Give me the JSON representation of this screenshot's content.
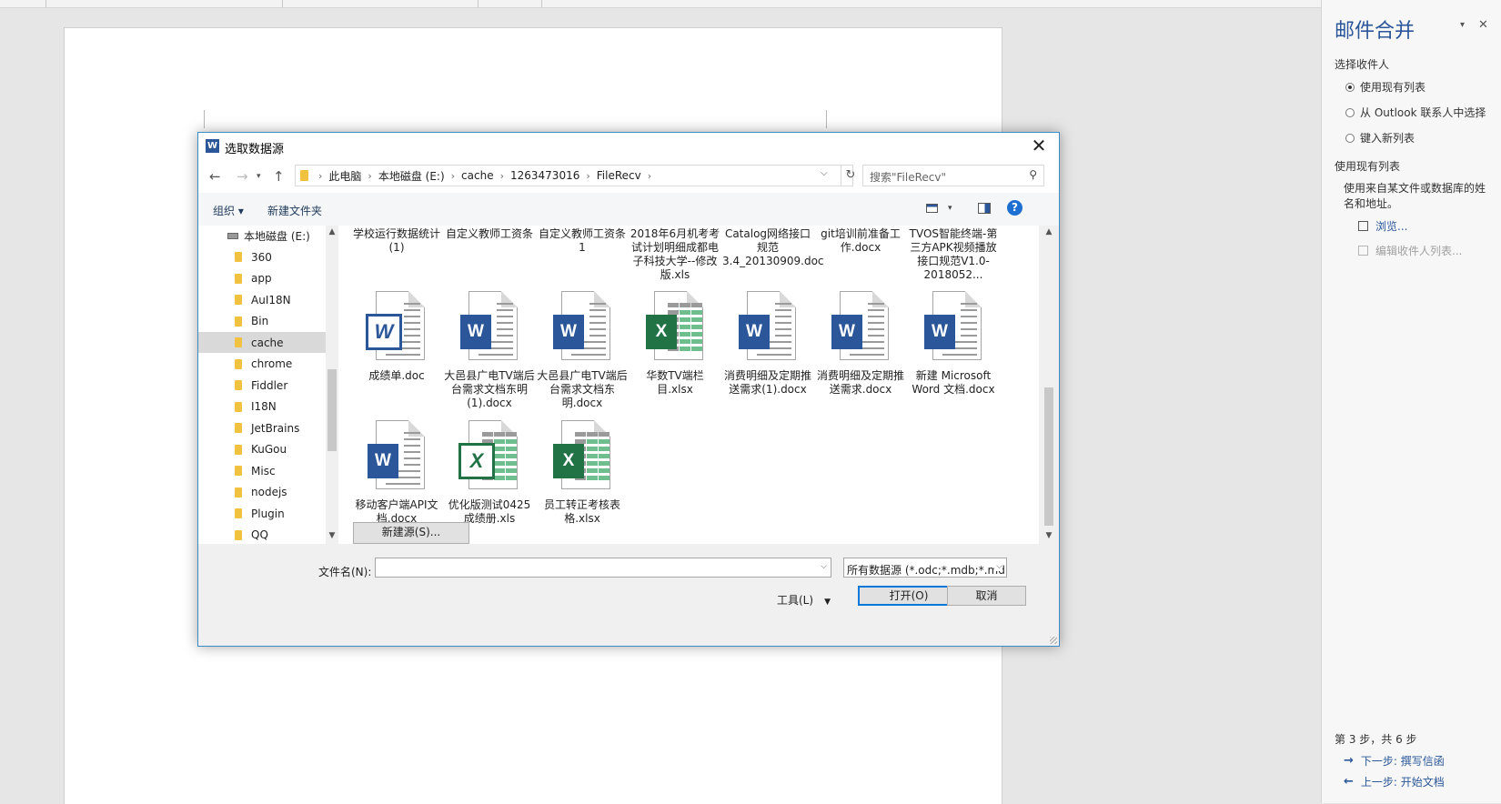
{
  "pane": {
    "title": "邮件合并",
    "section_select": "选择收件人",
    "options": [
      "使用现有列表",
      "从 Outlook 联系人中选择",
      "键入新列表"
    ],
    "section_use": "使用现有列表",
    "description": "使用来自某文件或数据库的姓名和地址。",
    "browse": "浏览...",
    "edit_list": "编辑收件人列表...",
    "step": "第 3 步，共 6 步",
    "next": "下一步: 撰写信函",
    "prev": "上一步: 开始文档",
    "accent": "#2b579a"
  },
  "dialog": {
    "title": "选取数据源",
    "breadcrumb": [
      "此电脑",
      "本地磁盘 (E:)",
      "cache",
      "1263473016",
      "FileRecv"
    ],
    "search_placeholder": "搜索\"FileRecv\"",
    "toolbar": {
      "organize": "组织 ▾",
      "new_folder": "新建文件夹"
    },
    "tree_drive": "本地磁盘 (E:)",
    "tree": [
      "360",
      "app",
      "AuI18N",
      "Bin",
      "cache",
      "chrome",
      "Fiddler",
      "I18N",
      "JetBrains",
      "KuGou",
      "Misc",
      "nodejs",
      "Plugin",
      "QQ"
    ],
    "tree_selected": "cache",
    "top_row": [
      "学校运行数据统计(1)",
      "自定义教师工资条",
      "自定义教师工资条1",
      "2018年6月机考考试计划明细成都电子科技大学--修改版.xls",
      "Catalog网络接口规范3.4_20130909.doc",
      "git培训前准备工作.docx",
      "TVOS智能终端-第三方APK视频播放接口规范V1.0-2018052..."
    ],
    "files": [
      {
        "name": "成绩单.doc",
        "kind": "word-old"
      },
      {
        "name": "大邑县广电TV端后台需求文档东明(1).docx",
        "kind": "word"
      },
      {
        "name": "大邑县广电TV端后台需求文档东明.docx",
        "kind": "word"
      },
      {
        "name": "华数TV端栏目.xlsx",
        "kind": "excel"
      },
      {
        "name": "消费明细及定期推送需求(1).docx",
        "kind": "word"
      },
      {
        "name": "消费明细及定期推送需求.docx",
        "kind": "word"
      },
      {
        "name": "新建 Microsoft Word 文档.docx",
        "kind": "word"
      },
      {
        "name": "移动客户端API文档.docx",
        "kind": "word"
      },
      {
        "name": "优化版测试0425成绩册.xls",
        "kind": "excel-old"
      },
      {
        "name": "员工转正考核表格.xlsx",
        "kind": "excel"
      }
    ],
    "new_source": "新建源(S)...",
    "filename_label": "文件名(N):",
    "filename_value": "",
    "filetype": "所有数据源 (*.odc;*.mdb;*.mdb",
    "tools": "工具(L)",
    "open": "打开(O)",
    "cancel": "取消",
    "colors": {
      "word": "#2b579a",
      "excel": "#217346"
    }
  }
}
